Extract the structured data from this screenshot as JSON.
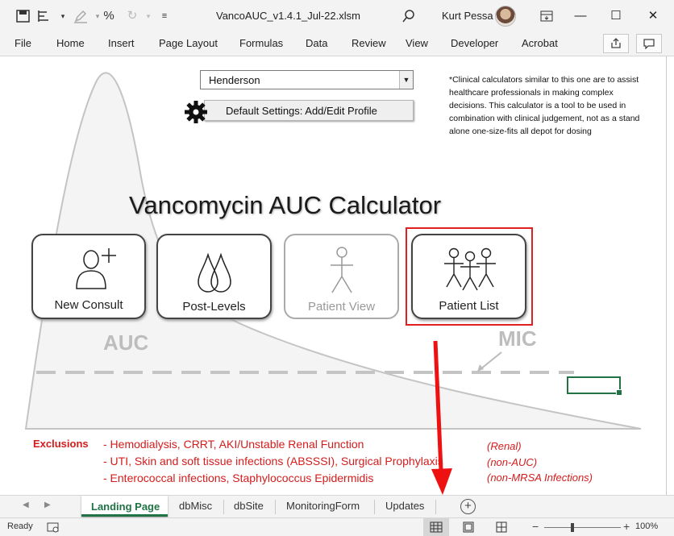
{
  "window": {
    "doc_title": "VancoAUC_v1.4.1_Jul-22.xlsm",
    "user_name": "Kurt Pessa",
    "buttons": {
      "minimize": "—",
      "maximize": "☐",
      "close": "✕"
    }
  },
  "ribbon": {
    "tabs": [
      "File",
      "Home",
      "Insert",
      "Page Layout",
      "Formulas",
      "Data",
      "Review",
      "View",
      "Developer",
      "Acrobat"
    ]
  },
  "sheet": {
    "profile_select": {
      "value": "Henderson"
    },
    "settings_button": "Default Settings: Add/Edit Profile",
    "disclaimer": "*Clinical calculators similar to this one are to assist healthcare professionals in making complex decisions. This calculator is a tool to be used in combination with clinical judgement, not as a stand alone one-size-fits all depot for dosing",
    "title": "Vancomycin AUC Calculator",
    "cards": [
      {
        "label": "New Consult",
        "icon": "person-add-icon"
      },
      {
        "label": "Post-Levels",
        "icon": "drops-icon"
      },
      {
        "label": "Patient View",
        "icon": "stick-figure-icon",
        "disabled": true
      },
      {
        "label": "Patient List",
        "icon": "group-icon",
        "highlighted": true
      }
    ],
    "curve_labels": {
      "auc": "AUC",
      "mic": "MIC"
    },
    "exclusions": {
      "title": "Exclusions",
      "items": [
        {
          "text": "- Hemodialysis, CRRT, AKI/Unstable Renal Function",
          "note": "(Renal)"
        },
        {
          "text": "- UTI, Skin and soft tissue infections (ABSSSI), Surgical Prophylaxis",
          "note": "(non-AUC)"
        },
        {
          "text": "- Enterococcal infections, Staphylococcus Epidermidis",
          "note": "(non-MRSA Infections)"
        }
      ]
    }
  },
  "sheet_tabs": {
    "active": "Landing Page",
    "others": [
      "dbMisc",
      "dbSite",
      "MonitoringForm",
      "Updates"
    ]
  },
  "status": {
    "ready": "Ready",
    "zoom": "100%"
  },
  "colors": {
    "accent": "#217346",
    "annotation": "#e02020",
    "exclusion_text": "#d41c1c"
  }
}
